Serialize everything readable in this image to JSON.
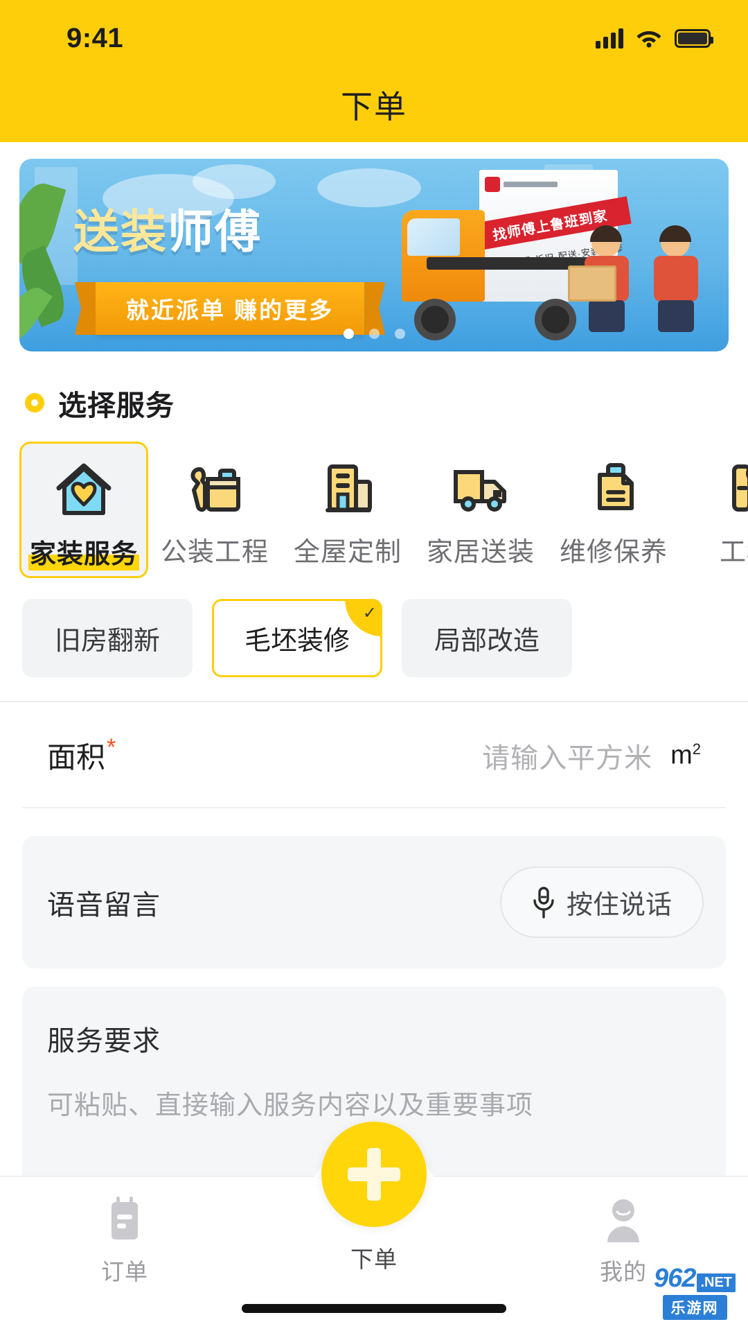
{
  "statusbar": {
    "time": "9:41",
    "signal_icon": "cellular-signal-icon",
    "wifi_icon": "wifi-icon",
    "battery_icon": "battery-icon"
  },
  "header": {
    "title": "下单"
  },
  "banner": {
    "title_part1": "送装",
    "title_part2": "师傅",
    "ribbon": "就近派单 赚的更多",
    "truck_brand": "鲁班到家",
    "truck_banner": "找师傅上鲁班到家",
    "truck_sub": "送货·量尺·拆旧·配送·安装·维修",
    "dots_total": 3,
    "dot_active_index": 0
  },
  "section": {
    "title": "选择服务",
    "bullet_icon": "ring-bullet-icon"
  },
  "categories": [
    {
      "label": "家装服务",
      "icon": "house-heart-icon",
      "selected": true
    },
    {
      "label": "公装工程",
      "icon": "wrench-toolbox-icon",
      "selected": false
    },
    {
      "label": "全屋定制",
      "icon": "building-icon",
      "selected": false
    },
    {
      "label": "家居送装",
      "icon": "delivery-truck-icon",
      "selected": false
    },
    {
      "label": "维修保养",
      "icon": "document-bottle-icon",
      "selected": false
    },
    {
      "label": "工程",
      "icon": "tool-icon",
      "selected": false
    }
  ],
  "sub_options": [
    {
      "label": "旧房翻新",
      "selected": false
    },
    {
      "label": "毛坯装修",
      "selected": true,
      "badge_icon": "check-icon",
      "badge_glyph": "✓"
    },
    {
      "label": "局部改造",
      "selected": false
    }
  ],
  "area_field": {
    "label": "面积",
    "required_mark": "*",
    "placeholder": "请输入平方米",
    "value": "",
    "unit": "m",
    "unit_sup": "2"
  },
  "voice": {
    "label": "语音留言",
    "button_label": "按住说话",
    "mic_icon": "microphone-icon"
  },
  "requirement": {
    "title": "服务要求",
    "placeholder": "可粘贴、直接输入服务内容以及重要事项",
    "value": ""
  },
  "tabbar": {
    "items": [
      {
        "label": "订单",
        "icon": "order-list-icon",
        "active": false
      },
      {
        "label": "下单",
        "icon": "plus-icon",
        "active": true
      },
      {
        "label": "我的",
        "icon": "user-profile-icon",
        "active": false
      }
    ]
  },
  "watermark": {
    "num": "962",
    "net": ".NET",
    "cn": "乐游网"
  },
  "colors": {
    "brand_yellow": "#FFCE0A",
    "accent_yellow": "#FFD60A",
    "required_red": "#F4511E",
    "banner_blue": "#62B6E8",
    "text_primary": "#1D1D1F",
    "text_muted": "#9A9A9F"
  }
}
